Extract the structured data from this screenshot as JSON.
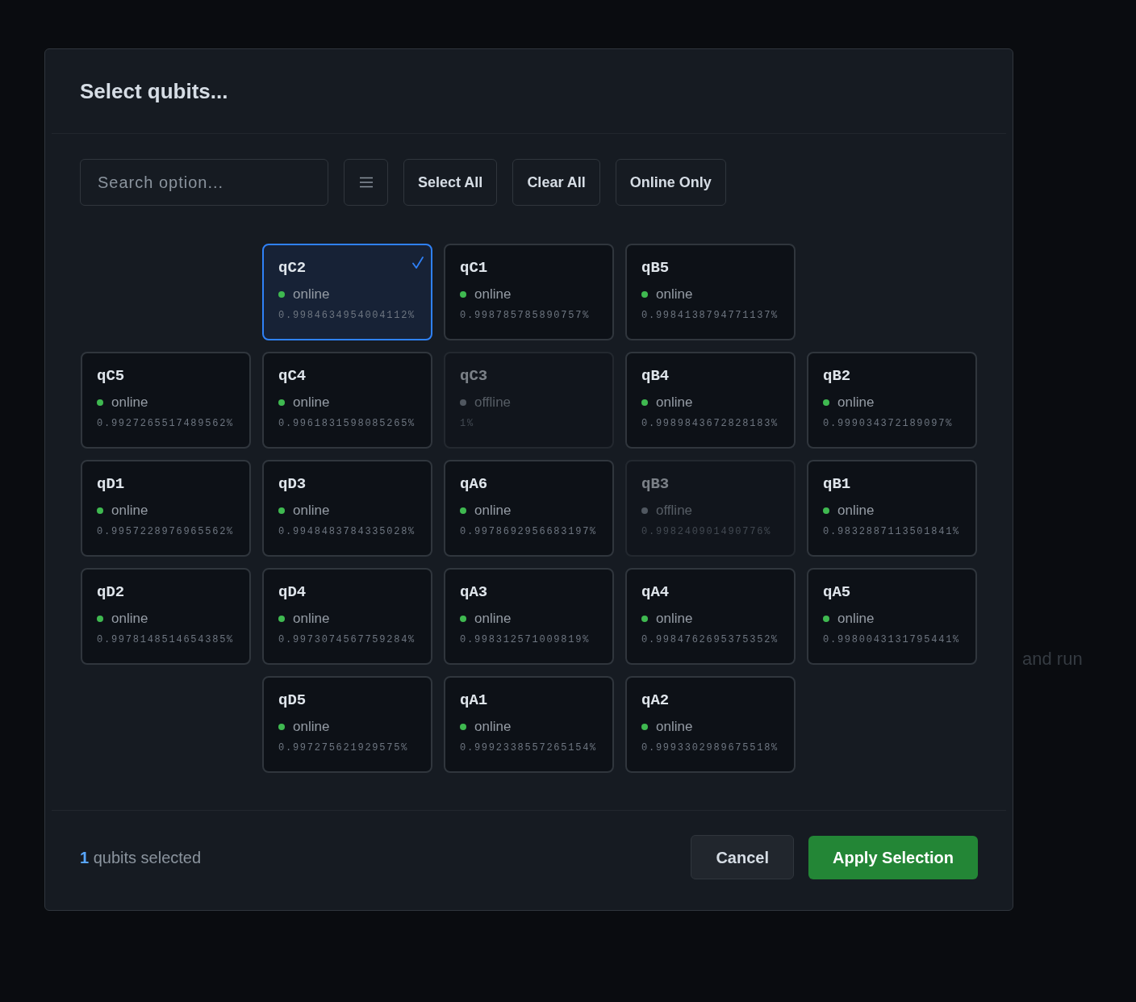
{
  "background_text": "and run",
  "dialog": {
    "title": "Select qubits..."
  },
  "toolbar": {
    "search": {
      "placeholder": "Search option..."
    },
    "buttons": [
      {
        "kind": "menu"
      },
      {
        "kind": "text",
        "label": "Select All"
      },
      {
        "kind": "text",
        "label": "Clear All"
      },
      {
        "kind": "text",
        "label": "Online Only"
      }
    ]
  },
  "grid": {
    "rows": [
      {
        "qubits": [
          {
            "name": "qC2",
            "online": true,
            "status": "online",
            "fidelity": "0.9984634954004112%",
            "selected": true
          },
          {
            "name": "qC1",
            "online": true,
            "status": "online",
            "fidelity": "0.998785785890757%",
            "selected": false
          },
          {
            "name": "qB5",
            "online": true,
            "status": "online",
            "fidelity": "0.9984138794771137%",
            "selected": false
          }
        ]
      },
      {
        "qubits": [
          {
            "name": "qC5",
            "online": true,
            "status": "online",
            "fidelity": "0.9927265517489562%",
            "selected": false
          },
          {
            "name": "qC4",
            "online": true,
            "status": "online",
            "fidelity": "0.9961831598085265%",
            "selected": false
          },
          {
            "name": "qC3",
            "online": false,
            "status": "offline",
            "fidelity": "1%",
            "selected": false
          },
          {
            "name": "qB4",
            "online": true,
            "status": "online",
            "fidelity": "0.9989843672828183%",
            "selected": false
          },
          {
            "name": "qB2",
            "online": true,
            "status": "online",
            "fidelity": "0.999034372189097%",
            "selected": false
          }
        ]
      },
      {
        "qubits": [
          {
            "name": "qD1",
            "online": true,
            "status": "online",
            "fidelity": "0.9957228976965562%",
            "selected": false
          },
          {
            "name": "qD3",
            "online": true,
            "status": "online",
            "fidelity": "0.9948483784335028%",
            "selected": false
          },
          {
            "name": "qA6",
            "online": true,
            "status": "online",
            "fidelity": "0.9978692956683197%",
            "selected": false
          },
          {
            "name": "qB3",
            "online": false,
            "status": "offline",
            "fidelity": "0.998240901490776%",
            "selected": false
          },
          {
            "name": "qB1",
            "online": true,
            "status": "online",
            "fidelity": "0.9832887113501841%",
            "selected": false
          }
        ]
      },
      {
        "qubits": [
          {
            "name": "qD2",
            "online": true,
            "status": "online",
            "fidelity": "0.9978148514654385%",
            "selected": false
          },
          {
            "name": "qD4",
            "online": true,
            "status": "online",
            "fidelity": "0.9973074567759284%",
            "selected": false
          },
          {
            "name": "qA3",
            "online": true,
            "status": "online",
            "fidelity": "0.998312571009819%",
            "selected": false
          },
          {
            "name": "qA4",
            "online": true,
            "status": "online",
            "fidelity": "0.9984762695375352%",
            "selected": false
          },
          {
            "name": "qA5",
            "online": true,
            "status": "online",
            "fidelity": "0.9980043131795441%",
            "selected": false
          }
        ]
      },
      {
        "qubits": [
          {
            "name": "qD5",
            "online": true,
            "status": "online",
            "fidelity": "0.997275621929575%",
            "selected": false
          },
          {
            "name": "qA1",
            "online": true,
            "status": "online",
            "fidelity": "0.9992338557265154%",
            "selected": false
          },
          {
            "name": "qA2",
            "online": true,
            "status": "online",
            "fidelity": "0.9993302989675518%",
            "selected": false
          }
        ]
      }
    ]
  },
  "footer": {
    "summary": "**1** qubits selected",
    "buttons": [
      {
        "kind": "secondary",
        "label": "Cancel"
      },
      {
        "kind": "primary",
        "label": "Apply Selection"
      }
    ]
  }
}
